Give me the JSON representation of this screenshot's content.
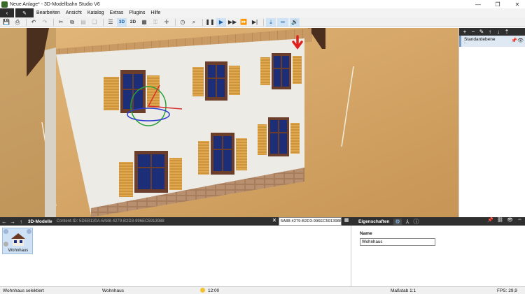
{
  "window": {
    "title": "Neue Anlage* - 3D-Modellbahn Studio V6",
    "minimize": "—",
    "restore": "❐",
    "close": "✕"
  },
  "menu": {
    "back_icon": "‹",
    "edit_icon": "✎",
    "items": [
      "Bearbeiten",
      "Ansicht",
      "Katalog",
      "Extras",
      "Plugins",
      "Hilfe"
    ]
  },
  "toolbar": {
    "view_3d": "3D",
    "view_2d": "2D"
  },
  "layers": {
    "items": [
      {
        "name": "Standardebene",
        "sub": "-"
      }
    ]
  },
  "catalog": {
    "title": "3D-Modelle",
    "content_id": "Content-ID: 5DEB130A-6A88-4279-B2D3-996EC5913988",
    "search_value": "5A88-4279-B2D3-996EC5913988",
    "tile_label": "Wohnhaus"
  },
  "properties": {
    "title": "Eigenschaften",
    "name_label": "Name",
    "name_value": "Wohnhaus"
  },
  "status": {
    "selection": "Wohnhaus selektiert",
    "object": "Wohnhaus",
    "time": "12:00",
    "scale": "Maßstab 1:1",
    "fps": "FPS: 29,9"
  },
  "colors": {
    "dark_panel": "#2f2f2f",
    "selection_blue": "#cfe2f5",
    "active_toolbar": "#cfe3f5"
  }
}
